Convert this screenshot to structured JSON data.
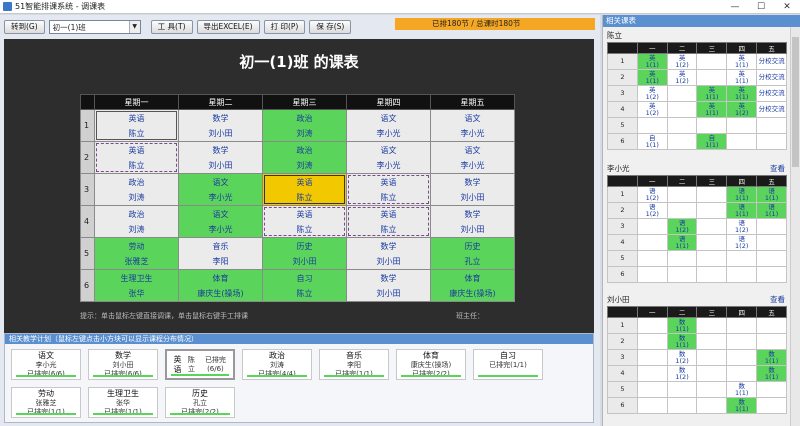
{
  "window": {
    "title": "51智能排课系统 - 调课表",
    "minimize": "—",
    "maximize": "☐",
    "close": "✕"
  },
  "toolbar": {
    "goto_label": "转到(G)",
    "class_select": "初一(1)班",
    "tools_label": "工 具(T)",
    "export_label": "导出EXCEL(E)",
    "print_label": "打 印(P)",
    "save_label": "保 存(S)"
  },
  "status": {
    "text": "已排180节 / 总课时180节"
  },
  "board": {
    "title": "初一(1)班 的课表",
    "days": [
      "星期一",
      "星期二",
      "星期三",
      "星期四",
      "星期五"
    ],
    "periods": [
      "1",
      "2",
      "3",
      "4",
      "5",
      "6"
    ],
    "rows": [
      [
        {
          "s": "英语",
          "t": "陈立",
          "c": "w",
          "b": "b"
        },
        {
          "s": "数学",
          "t": "刘小田",
          "c": "w"
        },
        {
          "s": "政治",
          "t": "刘涛",
          "c": "G"
        },
        {
          "s": "语文",
          "t": "李小光",
          "c": "w"
        },
        {
          "s": "语文",
          "t": "李小光",
          "c": "w"
        }
      ],
      [
        {
          "s": "英语",
          "t": "陈立",
          "c": "w",
          "b": "d"
        },
        {
          "s": "数学",
          "t": "刘小田",
          "c": "w"
        },
        {
          "s": "政治",
          "t": "刘涛",
          "c": "G"
        },
        {
          "s": "语文",
          "t": "李小光",
          "c": "w"
        },
        {
          "s": "语文",
          "t": "李小光",
          "c": "w"
        }
      ],
      [
        {
          "s": "政治",
          "t": "刘涛",
          "c": "w"
        },
        {
          "s": "语文",
          "t": "李小光",
          "c": "G"
        },
        {
          "s": "英语",
          "t": "陈立",
          "c": "y"
        },
        {
          "s": "英语",
          "t": "陈立",
          "c": "w",
          "b": "d"
        },
        {
          "s": "数学",
          "t": "刘小田",
          "c": "w"
        }
      ],
      [
        {
          "s": "政治",
          "t": "刘涛",
          "c": "w"
        },
        {
          "s": "语文",
          "t": "李小光",
          "c": "G"
        },
        {
          "s": "英语",
          "t": "陈立",
          "c": "w",
          "b": "d"
        },
        {
          "s": "英语",
          "t": "陈立",
          "c": "w",
          "b": "d"
        },
        {
          "s": "数学",
          "t": "刘小田",
          "c": "w"
        }
      ],
      [
        {
          "s": "劳动",
          "t": "张雅芝",
          "c": "G"
        },
        {
          "s": "音乐",
          "t": "李阳",
          "c": "w"
        },
        {
          "s": "历史",
          "t": "刘小田",
          "c": "G"
        },
        {
          "s": "数学",
          "t": "刘小田",
          "c": "w"
        },
        {
          "s": "历史",
          "t": "孔立",
          "c": "G"
        }
      ],
      [
        {
          "s": "生理卫生",
          "t": "张华",
          "c": "G"
        },
        {
          "s": "体育",
          "t": "康庆生(操场)",
          "c": "G"
        },
        {
          "s": "自习",
          "t": "陈立",
          "c": "G"
        },
        {
          "s": "数学",
          "t": "刘小田",
          "c": "w"
        },
        {
          "s": "体育",
          "t": "康庆生(操场)",
          "c": "G"
        }
      ]
    ],
    "hint": "提示：单击鼠标左键直接调课，单击鼠标右键手工排课",
    "teacher_label": "班主任："
  },
  "plan": {
    "header": "相关教学计划（鼠标左键点击小方块可以显示课程分布情况）",
    "cards": [
      {
        "n": "语文",
        "t": "李小光",
        "p": "已排完(6/6)"
      },
      {
        "n": "数学",
        "t": "刘小田",
        "p": "已排完(6/6)"
      },
      {
        "n": "英语",
        "t": "陈立",
        "p": "已排完(6/6)",
        "sel": true
      },
      {
        "n": "政治",
        "t": "刘涛",
        "p": "已排完(4/4)"
      },
      {
        "n": "音乐",
        "t": "李阳",
        "p": "已排完(1/1)"
      },
      {
        "n": "体育",
        "t": "康庆生(操场)",
        "p": "已排完(2/2)"
      },
      {
        "n": "自习",
        "t": "",
        "p": "已排完(1/1)"
      },
      {
        "n": "劳动",
        "t": "张雅芝",
        "p": "已排完(1/1)"
      },
      {
        "n": "生理卫生",
        "t": "张华",
        "p": "已排完(1/1)"
      },
      {
        "n": "历史",
        "t": "孔立",
        "p": "已排完(2/2)"
      }
    ]
  },
  "related": {
    "header": "相关课表",
    "days": [
      "一",
      "二",
      "三",
      "四",
      "五"
    ],
    "teachers": [
      {
        "name": "陈立",
        "view": "",
        "rows": [
          [
            [
              "英",
              "1(1)",
              "on"
            ],
            [
              "英",
              "1(2)",
              ""
            ],
            [
              "",
              "",
              ""
            ],
            [
              "英",
              "1(1)",
              ""
            ],
            [
              "分校交流",
              "",
              ""
            ]
          ],
          [
            [
              "英",
              "1(1)",
              "on"
            ],
            [
              "英",
              "1(2)",
              ""
            ],
            [
              "",
              "",
              ""
            ],
            [
              "英",
              "1(1)",
              ""
            ],
            [
              "分校交流",
              "",
              ""
            ]
          ],
          [
            [
              "英",
              "1(2)",
              ""
            ],
            [
              "",
              "",
              ""
            ],
            [
              "英",
              "1(1)",
              "on"
            ],
            [
              "英",
              "1(1)",
              "on"
            ],
            [
              "分校交流",
              "",
              ""
            ]
          ],
          [
            [
              "英",
              "1(2)",
              ""
            ],
            [
              "",
              "",
              ""
            ],
            [
              "英",
              "1(1)",
              "on"
            ],
            [
              "英",
              "1(2)",
              "on"
            ],
            [
              "分校交流",
              "",
              ""
            ]
          ],
          [
            [
              "",
              "",
              ""
            ],
            [
              "",
              "",
              ""
            ],
            [
              "",
              "",
              ""
            ],
            [
              "",
              "",
              ""
            ],
            [
              "",
              "",
              ""
            ]
          ],
          [
            [
              "自",
              "1(1)",
              ""
            ],
            [
              "",
              "",
              ""
            ],
            [
              "自",
              "1(1)",
              "on"
            ],
            [
              "",
              "",
              ""
            ],
            [
              "",
              "",
              ""
            ]
          ]
        ]
      },
      {
        "name": "李小光",
        "view": "查看",
        "rows": [
          [
            [
              "语",
              "1(2)",
              ""
            ],
            [
              "",
              "",
              ""
            ],
            [
              "",
              "",
              ""
            ],
            [
              "语",
              "1(1)",
              "on"
            ],
            [
              "语",
              "1(1)",
              "on"
            ]
          ],
          [
            [
              "语",
              "1(2)",
              ""
            ],
            [
              "",
              "",
              ""
            ],
            [
              "",
              "",
              ""
            ],
            [
              "语",
              "1(1)",
              "on"
            ],
            [
              "语",
              "1(1)",
              "on"
            ]
          ],
          [
            [
              "",
              "",
              ""
            ],
            [
              "语",
              "1(2)",
              "on"
            ],
            [
              "",
              "",
              ""
            ],
            [
              "语",
              "1(2)",
              ""
            ],
            [
              "",
              "",
              ""
            ]
          ],
          [
            [
              "",
              "",
              ""
            ],
            [
              "语",
              "1(1)",
              "on"
            ],
            [
              "",
              "",
              ""
            ],
            [
              "语",
              "1(2)",
              ""
            ],
            [
              "",
              "",
              ""
            ]
          ],
          [
            [
              "",
              "",
              ""
            ],
            [
              "",
              "",
              ""
            ],
            [
              "",
              "",
              ""
            ],
            [
              "",
              "",
              ""
            ],
            [
              "",
              "",
              ""
            ]
          ],
          [
            [
              "",
              "",
              ""
            ],
            [
              "",
              "",
              ""
            ],
            [
              "",
              "",
              ""
            ],
            [
              "",
              "",
              ""
            ],
            [
              "",
              "",
              ""
            ]
          ]
        ]
      },
      {
        "name": "刘小田",
        "view": "查看",
        "rows": [
          [
            [
              "",
              "",
              ""
            ],
            [
              "数",
              "1(1)",
              "on"
            ],
            [
              "",
              "",
              ""
            ],
            [
              "",
              "",
              ""
            ],
            [
              "",
              "",
              ""
            ]
          ],
          [
            [
              "",
              "",
              ""
            ],
            [
              "数",
              "1(1)",
              "on"
            ],
            [
              "",
              "",
              ""
            ],
            [
              "",
              "",
              ""
            ],
            [
              "",
              "",
              ""
            ]
          ],
          [
            [
              "",
              "",
              ""
            ],
            [
              "数",
              "1(2)",
              ""
            ],
            [
              "",
              "",
              ""
            ],
            [
              "",
              "",
              ""
            ],
            [
              "数",
              "1(1)",
              "on"
            ]
          ],
          [
            [
              "",
              "",
              ""
            ],
            [
              "数",
              "1(2)",
              ""
            ],
            [
              "",
              "",
              ""
            ],
            [
              "",
              "",
              ""
            ],
            [
              "数",
              "1(1)",
              "on"
            ]
          ],
          [
            [
              "",
              "",
              ""
            ],
            [
              "",
              "",
              ""
            ],
            [
              "",
              "",
              ""
            ],
            [
              "数",
              "1(1)",
              ""
            ],
            [
              "",
              "",
              ""
            ]
          ],
          [
            [
              "",
              "",
              ""
            ],
            [
              "",
              "",
              ""
            ],
            [
              "",
              "",
              ""
            ],
            [
              "数",
              "1(1)",
              "on"
            ],
            [
              "",
              "",
              ""
            ]
          ]
        ]
      }
    ]
  }
}
